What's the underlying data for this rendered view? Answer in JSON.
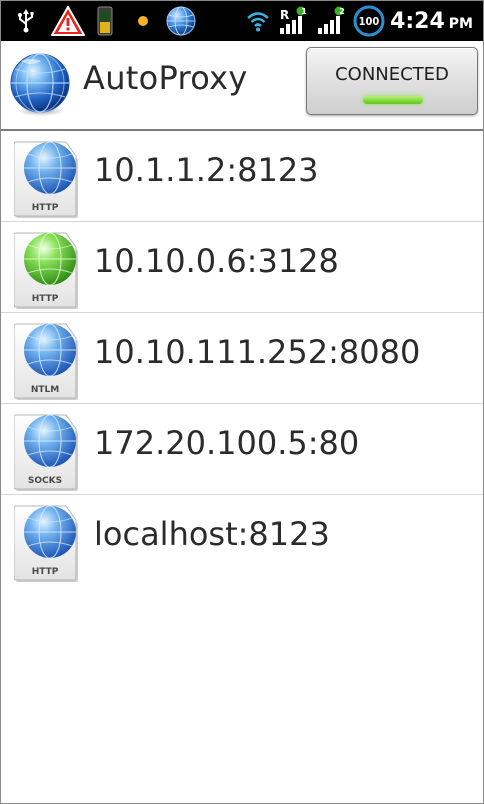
{
  "status_bar": {
    "icons": [
      "usb-icon",
      "warning-icon",
      "battery-icon",
      "notification-dot-icon",
      "globe-icon",
      "wifi-icon",
      "signal-icon",
      "signal-icon",
      "battery-circle-icon"
    ],
    "signal_r_badge": "1",
    "signal_badge": "2",
    "battery_level": "100",
    "time": "4:24",
    "ampm": "PM"
  },
  "action_bar": {
    "title": "AutoProxy",
    "connect_button": {
      "label": "CONNECTED",
      "indicator_color": "#6fd22a"
    }
  },
  "proxies": [
    {
      "address": "10.1.1.2:8123",
      "type": "HTTP",
      "globe_color": "blue"
    },
    {
      "address": "10.10.0.6:3128",
      "type": "HTTP",
      "globe_color": "green"
    },
    {
      "address": "10.10.111.252:8080",
      "type": "NTLM",
      "globe_color": "blue"
    },
    {
      "address": "172.20.100.5:80",
      "type": "SOCKS",
      "globe_color": "blue"
    },
    {
      "address": "localhost:8123",
      "type": "HTTP",
      "globe_color": "blue"
    }
  ]
}
